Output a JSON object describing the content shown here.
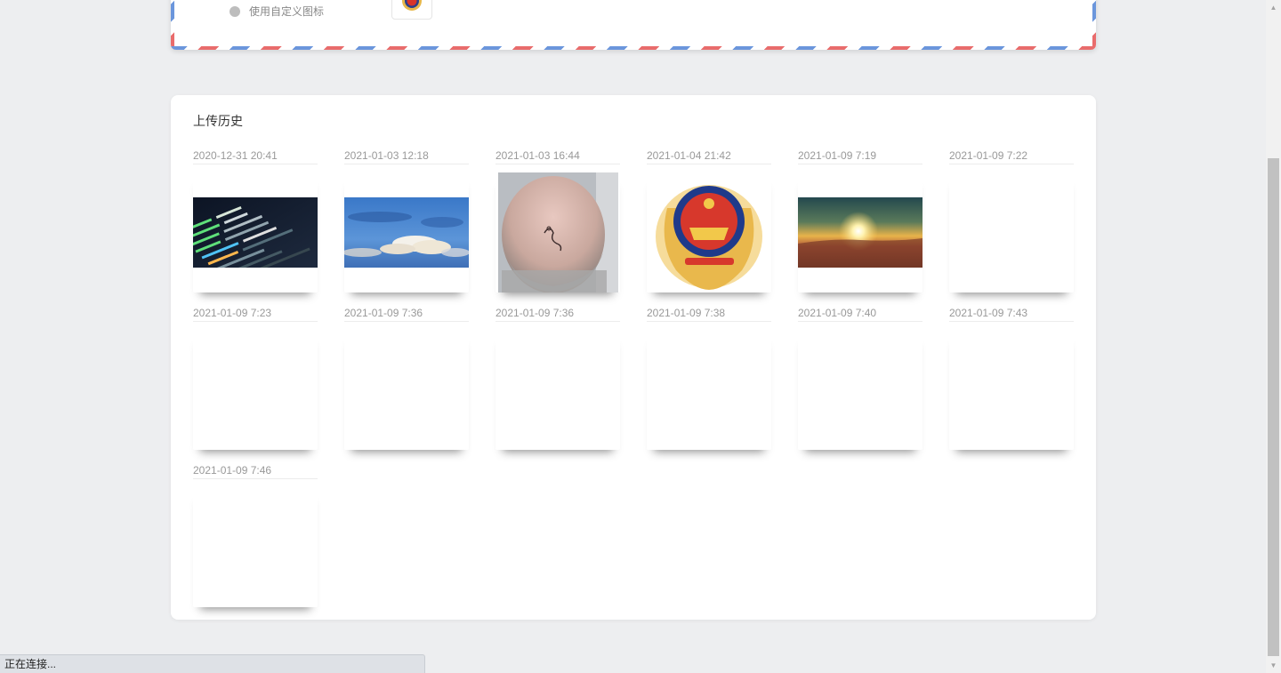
{
  "top_card": {
    "custom_icon_label": "使用自定义图标"
  },
  "history": {
    "title": "上传历史",
    "items": [
      {
        "date": "2020-12-31 20:41",
        "thumb": "code-screen-image"
      },
      {
        "date": "2021-01-03 12:18",
        "thumb": "blue-sky-clouds-image"
      },
      {
        "date": "2021-01-03 16:44",
        "thumb": "bald-head-image"
      },
      {
        "date": "2021-01-04 21:42",
        "thumb": "police-emblem-image"
      },
      {
        "date": "2021-01-09 7:19",
        "thumb": "sunrise-image"
      },
      {
        "date": "2021-01-09 7:22",
        "thumb": "blank"
      },
      {
        "date": "2021-01-09 7:23",
        "thumb": "blank"
      },
      {
        "date": "2021-01-09 7:36",
        "thumb": "blank"
      },
      {
        "date": "2021-01-09 7:36",
        "thumb": "blank"
      },
      {
        "date": "2021-01-09 7:38",
        "thumb": "blank"
      },
      {
        "date": "2021-01-09 7:40",
        "thumb": "blank"
      },
      {
        "date": "2021-01-09 7:43",
        "thumb": "blank"
      },
      {
        "date": "2021-01-09 7:46",
        "thumb": "blank"
      }
    ]
  },
  "status_bar": {
    "text": "正在连接..."
  },
  "scrollbar": {
    "up_icon": "scroll-up-arrow-icon",
    "down_icon": "scroll-down-arrow-icon"
  },
  "colors": {
    "page_bg": "#edeef0",
    "airmail_red": "#e96c6c",
    "airmail_blue": "#6b96dc"
  }
}
